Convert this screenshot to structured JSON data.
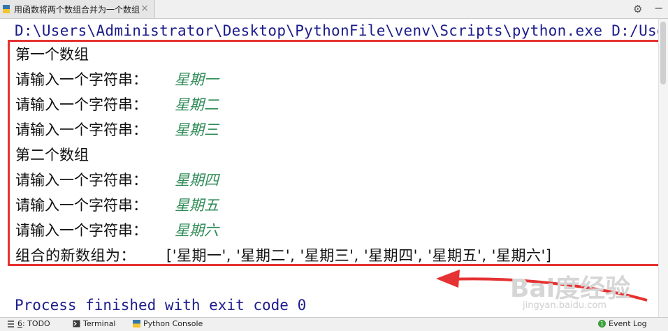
{
  "tab": {
    "title": "用函数将两个数组合并为一个数组",
    "close": "×"
  },
  "toolbar": {
    "settings": "⚙",
    "hide": "−"
  },
  "console": {
    "command": "D:\\Users\\Administrator\\Desktop\\PythonFile\\venv\\Scripts\\python.exe D:/Users/Adm",
    "lines": [
      {
        "prompt": "第一个数组",
        "input": ""
      },
      {
        "prompt": "请输入一个字符串：",
        "input": "星期一"
      },
      {
        "prompt": "请输入一个字符串：",
        "input": "星期二"
      },
      {
        "prompt": "请输入一个字符串：",
        "input": "星期三"
      },
      {
        "prompt": "第二个数组",
        "input": ""
      },
      {
        "prompt": "请输入一个字符串：",
        "input": "星期四"
      },
      {
        "prompt": "请输入一个字符串：",
        "input": "星期五"
      },
      {
        "prompt": "请输入一个字符串：",
        "input": "星期六"
      }
    ],
    "result_label": "组合的新数组为：",
    "result_value": "['星期一', '星期二', '星期三', '星期四', '星期五', '星期六']",
    "exit": "Process finished with exit code 0"
  },
  "watermark": {
    "main": "Bai度经验",
    "sub": "jingyan.baidu.com"
  },
  "statusbar": {
    "todo_num": "6",
    "todo_label": ": TODO",
    "terminal": "Terminal",
    "python_console": "Python Console",
    "event_count": "1",
    "event_log": "Event Log"
  },
  "colors": {
    "highlight_box": "#e63232",
    "input_text": "#2e8b57",
    "command_text": "#1c1c8c"
  }
}
